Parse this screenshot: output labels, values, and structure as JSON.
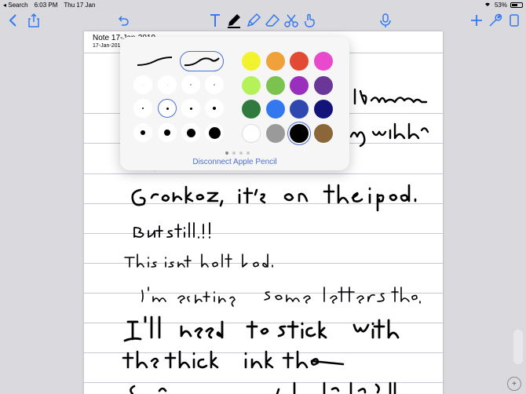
{
  "status_bar": {
    "back_app": "Search",
    "time": "6:03 PM",
    "date": "Thu 17 Jan",
    "battery": "53%",
    "battery_level": 0.53
  },
  "toolbar": {
    "icons": [
      "back-icon",
      "share-icon",
      "undo-icon",
      "text-tool-icon",
      "pen-tool-icon",
      "highlighter-icon",
      "eraser-icon",
      "scissors-icon",
      "finger-icon",
      "microphone-icon",
      "add-icon",
      "wrench-icon",
      "pages-icon"
    ]
  },
  "note": {
    "title": "Note 17-Jan-2019",
    "date": "17-Jan-2019"
  },
  "popover": {
    "disconnect_label": "Disconnect Apple Pencil",
    "colors": [
      "#f3f22e",
      "#f0a13a",
      "#e24a33",
      "#e84acd",
      "#b5f25a",
      "#7bc24f",
      "#9a2fbe",
      "#6a3697",
      "#2f7a3c",
      "#3478f0",
      "#2f48b0",
      "#13137a",
      "#ffffff",
      "#9a9a9a",
      "#000000",
      "#8a6638"
    ],
    "selected_color": "#000000"
  }
}
